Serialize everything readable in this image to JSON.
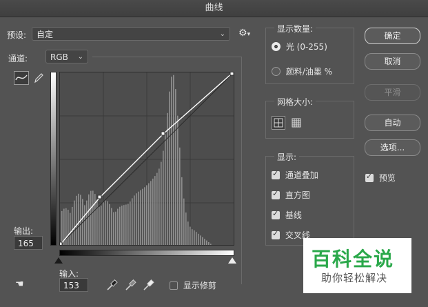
{
  "window": {
    "title": "曲线"
  },
  "preset": {
    "label": "预设:",
    "value": "自定"
  },
  "channel": {
    "label": "通道:",
    "value": "RGB"
  },
  "output": {
    "label": "输出:",
    "value": "165"
  },
  "input": {
    "label": "输入:",
    "value": "153"
  },
  "clipping": {
    "label": "显示修剪"
  },
  "display_amount": {
    "title": "显示数量:",
    "light": "光 (0-255)",
    "pigment": "颜料/油墨 %"
  },
  "grid_size": {
    "title": "网格大小:"
  },
  "display": {
    "title": "显示:",
    "items": [
      "通道叠加",
      "直方图",
      "基线",
      "交叉线"
    ]
  },
  "buttons": {
    "ok": "确定",
    "cancel": "取消",
    "smooth": "平滑",
    "auto": "自动",
    "options": "选项..."
  },
  "preview": {
    "label": "预览"
  },
  "watermark": {
    "line1": "百科全说",
    "line2": "助你轻松解决"
  }
}
